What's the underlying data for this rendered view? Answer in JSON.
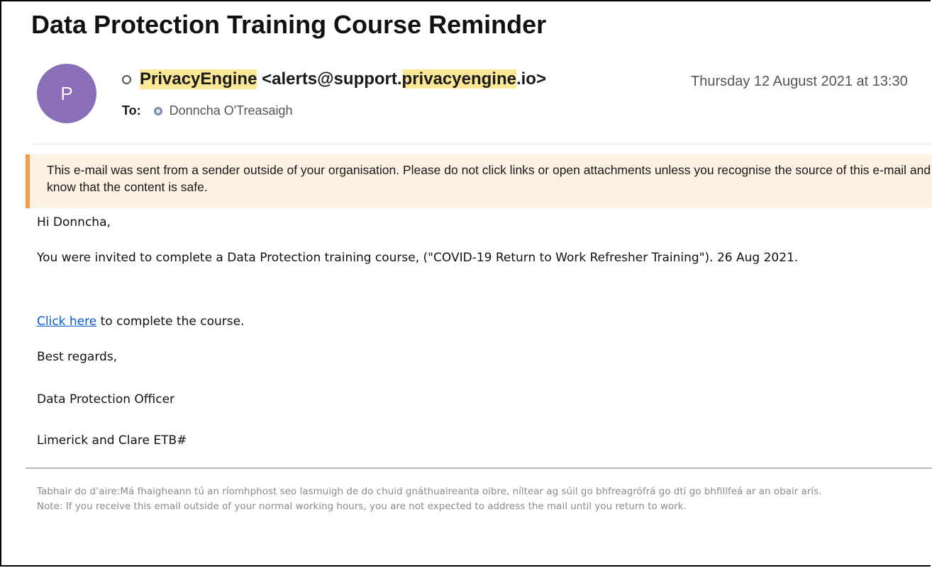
{
  "email": {
    "subject": "Data Protection Training Course Reminder",
    "avatar_initial": "P",
    "from": {
      "name": "PrivacyEngine",
      "email_prefix": "<alerts@support.",
      "email_domain_highlight": "privacyengine",
      "email_suffix": ".io>"
    },
    "date": "Thursday 12 August 2021 at 13:30",
    "to_label": "To:",
    "to_name": "Donncha O'Treasaigh",
    "external_warning": "This e-mail was sent from a sender outside of your organisation. Please do not click links or open attachments unless you recognise the source of this e-mail and know that the content is safe.",
    "body": {
      "greeting": "Hi Donncha,",
      "invitation": "You were invited to complete a Data Protection training course, (\"COVID-19 Return to Work Refresher Training\"). 26 Aug 2021.",
      "link_text": "Click here",
      "link_suffix": " to complete the course.",
      "regards": "Best regards,",
      "signature_title": "Data Protection Officer",
      "signature_org": "Limerick and Clare ETB#"
    },
    "footer": {
      "irish_notice": "Tabhair do d’aire:Má fhaigheann tú an ríomhphost seo lasmuigh de do chuid gnáthuaireanta oibre, níltear ag súil go bhfreagrófrá go dtí go bhfillfeá ar an obair arís.",
      "english_notice": "Note: If you receive this email outside of your normal working hours, you are not expected to address the mail until you return to work."
    }
  },
  "colors": {
    "avatar": "#8a6fb8",
    "highlight": "#fbe896",
    "warning_bg": "#fdf1e4",
    "warning_border": "#f0a04b",
    "link": "#0b5cd6"
  }
}
